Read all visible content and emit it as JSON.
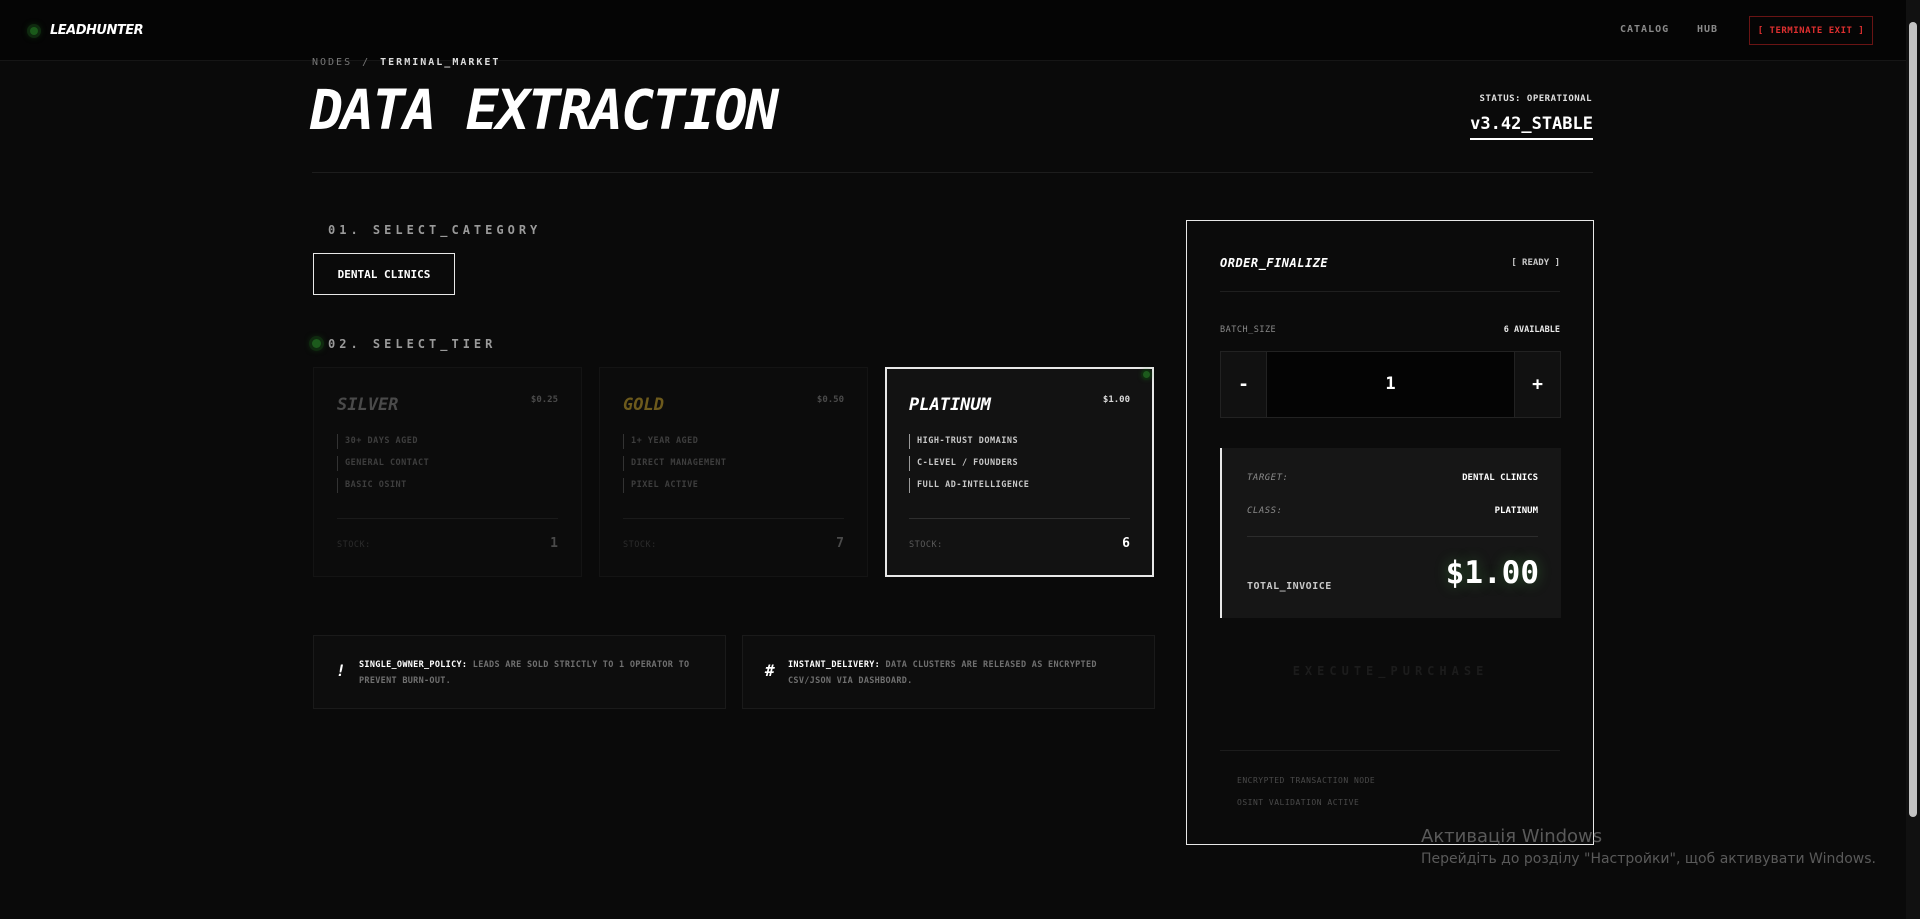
{
  "nav": {
    "logo": "LEADHUNTER",
    "links": [
      "CATALOG",
      "HUB"
    ],
    "exit_label": "[ TERMINATE EXIT ]"
  },
  "header": {
    "breadcrumb": [
      "NODES",
      "TERMINAL_MARKET"
    ],
    "breadcrumb_sep": "/",
    "title": "DATA EXTRACTION",
    "status": "STATUS: OPERATIONAL",
    "version": "v3.42_STABLE"
  },
  "category": {
    "heading": "01. SELECT_CATEGORY",
    "selected": "DENTAL CLINICS"
  },
  "tiers": {
    "heading": "02. SELECT_TIER",
    "stock_label": "STOCK:",
    "items": [
      {
        "name": "SILVER",
        "price": "$0.25",
        "features": [
          "30+ DAYS AGED",
          "GENERAL CONTACT",
          "BASIC OSINT"
        ],
        "stock": "1"
      },
      {
        "name": "GOLD",
        "price": "$0.50",
        "features": [
          "1+ YEAR AGED",
          "DIRECT MANAGEMENT",
          "PIXEL ACTIVE"
        ],
        "stock": "7"
      },
      {
        "name": "PLATINUM",
        "price": "$1.00",
        "features": [
          "HIGH-TRUST DOMAINS",
          "C-LEVEL / FOUNDERS",
          "FULL AD-INTELLIGENCE"
        ],
        "stock": "6"
      }
    ],
    "selected": "PLATINUM"
  },
  "info": [
    {
      "icon": "!",
      "key": "SINGLE_OWNER_POLICY:",
      "text": "LEADS ARE SOLD STRICTLY TO 1 OPERATOR TO PREVENT BURN-OUT."
    },
    {
      "icon": "#",
      "key": "INSTANT_DELIVERY:",
      "text": "DATA CLUSTERS ARE RELEASED AS ENCRYPTED CSV/JSON VIA DASHBOARD."
    }
  ],
  "order": {
    "title": "ORDER_FINALIZE",
    "ready": "[ READY ]",
    "batch_label": "BATCH_SIZE",
    "available": "6 AVAILABLE",
    "minus": "-",
    "plus": "+",
    "quantity": "1",
    "target_label": "TARGET:",
    "target_value": "DENTAL CLINICS",
    "class_label": "CLASS:",
    "class_value": "PLATINUM",
    "total_label": "TOTAL_INVOICE",
    "total_value": "$1.00",
    "execute": "EXECUTE_PURCHASE",
    "footer": [
      "ENCRYPTED TRANSACTION NODE",
      "OSINT VALIDATION ACTIVE"
    ]
  },
  "watermark": {
    "line1": "Активація Windows",
    "line2": "Перейдіть до розділу \"Настройки\", щоб активувати Windows."
  },
  "colors": {
    "accent_green": "#1f6b1f",
    "danger": "#e03030",
    "gold": "#6d5a1c"
  }
}
